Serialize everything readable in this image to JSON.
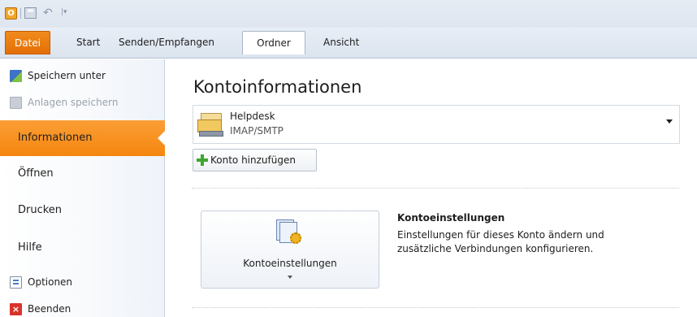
{
  "quick_access": {
    "app_icon": "outlook-icon",
    "app_letter": "O",
    "save_icon": "save-icon",
    "undo_icon": "undo-icon",
    "undo_glyph": "↶",
    "customize_glyph": "|▾"
  },
  "ribbon": {
    "tabs": [
      {
        "label": "Datei"
      },
      {
        "label": "Start"
      },
      {
        "label": "Senden/Empfangen"
      },
      {
        "label": "Ordner"
      },
      {
        "label": "Ansicht"
      }
    ]
  },
  "nav": {
    "save_as": {
      "label": "Speichern unter",
      "icon": "save-as-icon"
    },
    "save_attachments": {
      "label": "Anlagen speichern",
      "icon": "save-attachments-icon"
    },
    "info": {
      "label": "Informationen"
    },
    "open": {
      "label": "Öffnen"
    },
    "print": {
      "label": "Drucken"
    },
    "help": {
      "label": "Hilfe"
    },
    "options": {
      "label": "Optionen",
      "icon": "options-icon"
    },
    "exit": {
      "label": "Beenden",
      "icon": "exit-icon",
      "glyph": "×"
    }
  },
  "main": {
    "title": "Kontoinformationen",
    "account": {
      "name": "Helpdesk",
      "type": "IMAP/SMTP",
      "icon": "mail-account-icon"
    },
    "add_account": {
      "label": "Konto hinzufügen",
      "icon": "plus-icon"
    },
    "account_settings": {
      "button_label": "Kontoeinstellungen",
      "icon": "account-settings-icon",
      "heading": "Kontoeinstellungen",
      "description": "Einstellungen für dieses Konto ändern und zusätzliche Verbindungen konfigurieren."
    }
  },
  "colors": {
    "accent_orange": "#f4860f",
    "ribbon_bg": "#dce4ef",
    "plus_green": "#3fa630"
  }
}
